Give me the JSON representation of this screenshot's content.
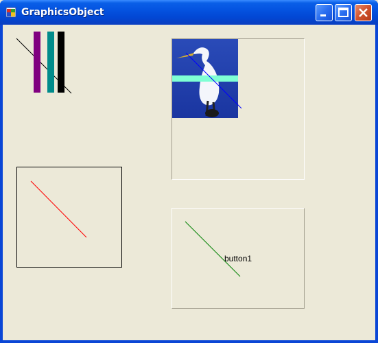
{
  "window": {
    "title": "GraphicsObject"
  },
  "controls": {
    "button_label": "button1"
  },
  "icons": {
    "app": "app-window-icon",
    "minimize": "minimize-icon",
    "maximize": "maximize-icon",
    "close": "close-icon",
    "image": "egret-photo"
  },
  "colors": {
    "stripe_1": "#800080",
    "stripe_2": "#008b8b",
    "stripe_3": "#000000",
    "highlight_band": "#7fffd4",
    "red_line": "#ff0000",
    "green_line": "#008000",
    "blue_line": "#0000ff"
  }
}
